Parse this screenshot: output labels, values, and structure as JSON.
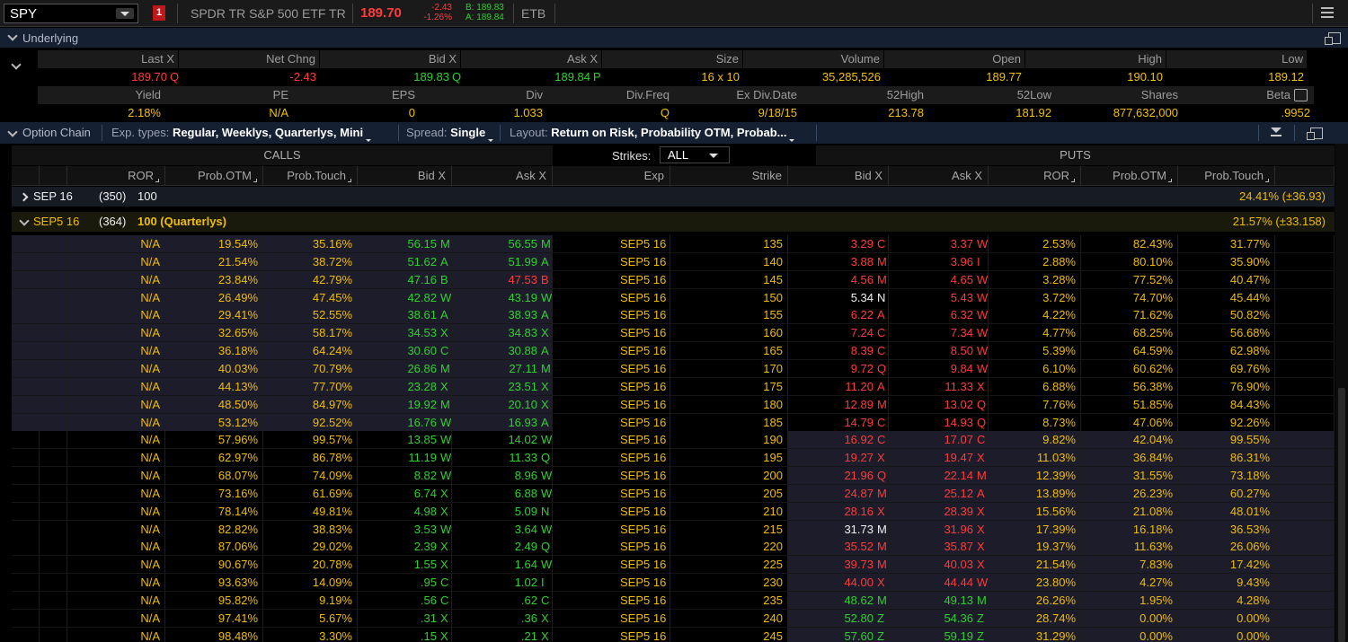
{
  "toolbar": {
    "symbol": "SPY",
    "alert_badge": "1",
    "description": "SPDR TR S&P 500 ETF TR",
    "last": "189.70",
    "net_change": "-2.43",
    "pct_change": "-1.26%",
    "bid_label": "B: 189.83",
    "ask_label": "A: 189.84",
    "etb": "ETB",
    "menu_icon": "hamburger-menu-icon"
  },
  "underlying": {
    "title": "Underlying",
    "row1_headers": [
      "Last X",
      "Net Chng",
      "Bid X",
      "Ask X",
      "Size",
      "Volume",
      "Open",
      "High",
      "Low"
    ],
    "row1_values": [
      {
        "v": "189.70",
        "x": "Q",
        "c": "red"
      },
      {
        "v": "-2.43",
        "x": "",
        "c": "red"
      },
      {
        "v": "189.83",
        "x": "Q",
        "c": "grn"
      },
      {
        "v": "189.84",
        "x": "P",
        "c": "grn"
      },
      {
        "v": "16 x 10",
        "x": "",
        "c": ""
      },
      {
        "v": "35,285,526",
        "x": "",
        "c": ""
      },
      {
        "v": "189.77",
        "x": "",
        "c": ""
      },
      {
        "v": "190.10",
        "x": "",
        "c": ""
      },
      {
        "v": "189.12",
        "x": "",
        "c": ""
      }
    ],
    "row2_headers": [
      "Yield",
      "PE",
      "EPS",
      "Div",
      "Div.Freq",
      "Ex Div.Date",
      "52High",
      "52Low",
      "Shares",
      "Beta"
    ],
    "row2_values": [
      "2.18%",
      "N/A",
      "0",
      "1.033",
      "Q",
      "9/18/15",
      "213.78",
      "181.92",
      "877,632,000",
      ".9952"
    ]
  },
  "option_chain": {
    "title": "Option Chain",
    "exp_types_label": "Exp. types:",
    "exp_types_value": "Regular, Weeklys, Quarterlys, Mini",
    "spread_label": "Spread:",
    "spread_value": "Single",
    "layout_label": "Layout:",
    "layout_value": "Return on Risk, Probability OTM, Probab...",
    "calls_label": "CALLS",
    "puts_label": "PUTS",
    "strikes_label": "Strikes:",
    "strikes_value": "ALL",
    "headers": [
      "ROR",
      "Prob.OTM",
      "Prob.Touch",
      "Bid X",
      "Ask X",
      "Exp",
      "Strike",
      "Bid X",
      "Ask X",
      "ROR",
      "Prob.OTM",
      "Prob.Touch"
    ],
    "expirations": [
      {
        "name": "SEP 16",
        "days": "(350)",
        "mult": "100",
        "iv": "24.41% (±36.93)",
        "expanded": false
      },
      {
        "name": "SEP5 16",
        "days": "(364)",
        "mult": "100 (Quarterlys)",
        "iv": "21.57% (±33.158)",
        "expanded": true
      }
    ],
    "rows": [
      [
        "N/A",
        "19.54%",
        "35.16%",
        "56.15",
        "M",
        "56.55",
        "M",
        "SEP5 16",
        "135",
        "3.29",
        "C",
        "3.37",
        "W",
        "2.53%",
        "82.43%",
        "31.77%"
      ],
      [
        "N/A",
        "21.54%",
        "38.72%",
        "51.62",
        "A",
        "51.99",
        "A",
        "SEP5 16",
        "140",
        "3.88",
        "M",
        "3.96",
        "I",
        "2.88%",
        "80.10%",
        "35.90%"
      ],
      [
        "N/A",
        "23.84%",
        "42.79%",
        "47.16",
        "B",
        "47.53",
        "B",
        "SEP5 16",
        "145",
        "4.56",
        "M",
        "4.65",
        "W",
        "3.28%",
        "77.52%",
        "40.47%"
      ],
      [
        "N/A",
        "26.49%",
        "47.45%",
        "42.82",
        "W",
        "43.19",
        "W",
        "SEP5 16",
        "150",
        "5.34",
        "N",
        "5.43",
        "W",
        "3.72%",
        "74.70%",
        "45.44%"
      ],
      [
        "N/A",
        "29.41%",
        "52.55%",
        "38.61",
        "A",
        "38.93",
        "A",
        "SEP5 16",
        "155",
        "6.22",
        "A",
        "6.32",
        "W",
        "4.22%",
        "71.62%",
        "50.82%"
      ],
      [
        "N/A",
        "32.65%",
        "58.17%",
        "34.53",
        "X",
        "34.83",
        "X",
        "SEP5 16",
        "160",
        "7.24",
        "C",
        "7.34",
        "W",
        "4.77%",
        "68.25%",
        "56.68%"
      ],
      [
        "N/A",
        "36.18%",
        "64.24%",
        "30.60",
        "C",
        "30.88",
        "A",
        "SEP5 16",
        "165",
        "8.39",
        "C",
        "8.50",
        "W",
        "5.39%",
        "64.59%",
        "62.98%"
      ],
      [
        "N/A",
        "40.03%",
        "70.79%",
        "26.86",
        "M",
        "27.11",
        "M",
        "SEP5 16",
        "170",
        "9.72",
        "Q",
        "9.84",
        "W",
        "6.10%",
        "60.62%",
        "69.76%"
      ],
      [
        "N/A",
        "44.13%",
        "77.70%",
        "23.28",
        "X",
        "23.51",
        "X",
        "SEP5 16",
        "175",
        "11.20",
        "A",
        "11.33",
        "X",
        "6.88%",
        "56.38%",
        "76.90%"
      ],
      [
        "N/A",
        "48.50%",
        "84.97%",
        "19.92",
        "M",
        "20.10",
        "X",
        "SEP5 16",
        "180",
        "12.89",
        "M",
        "13.02",
        "Q",
        "7.76%",
        "51.85%",
        "84.43%"
      ],
      [
        "N/A",
        "53.12%",
        "92.52%",
        "16.76",
        "W",
        "16.93",
        "A",
        "SEP5 16",
        "185",
        "14.79",
        "C",
        "14.93",
        "Q",
        "8.73%",
        "47.06%",
        "92.26%"
      ],
      [
        "N/A",
        "57.96%",
        "99.57%",
        "13.85",
        "W",
        "14.02",
        "W",
        "SEP5 16",
        "190",
        "16.92",
        "C",
        "17.07",
        "C",
        "9.82%",
        "42.04%",
        "99.55%"
      ],
      [
        "N/A",
        "62.97%",
        "86.78%",
        "11.19",
        "W",
        "11.33",
        "Q",
        "SEP5 16",
        "195",
        "19.27",
        "X",
        "19.47",
        "X",
        "11.03%",
        "36.84%",
        "86.31%"
      ],
      [
        "N/A",
        "68.07%",
        "74.09%",
        "8.82",
        "W",
        "8.96",
        "W",
        "SEP5 16",
        "200",
        "21.96",
        "Q",
        "22.14",
        "M",
        "12.39%",
        "31.55%",
        "73.18%"
      ],
      [
        "N/A",
        "73.16%",
        "61.69%",
        "6.74",
        "X",
        "6.88",
        "W",
        "SEP5 16",
        "205",
        "24.87",
        "M",
        "25.12",
        "A",
        "13.89%",
        "26.23%",
        "60.27%"
      ],
      [
        "N/A",
        "78.14%",
        "49.81%",
        "4.98",
        "X",
        "5.09",
        "N",
        "SEP5 16",
        "210",
        "28.16",
        "X",
        "28.39",
        "X",
        "15.56%",
        "21.08%",
        "48.01%"
      ],
      [
        "N/A",
        "82.82%",
        "38.83%",
        "3.53",
        "W",
        "3.64",
        "W",
        "SEP5 16",
        "215",
        "31.73",
        "M",
        "31.96",
        "X",
        "17.39%",
        "16.18%",
        "36.53%"
      ],
      [
        "N/A",
        "87.06%",
        "29.02%",
        "2.39",
        "X",
        "2.49",
        "Q",
        "SEP5 16",
        "220",
        "35.52",
        "M",
        "35.87",
        "X",
        "19.37%",
        "11.63%",
        "26.06%"
      ],
      [
        "N/A",
        "90.67%",
        "20.78%",
        "1.55",
        "X",
        "1.64",
        "W",
        "SEP5 16",
        "225",
        "39.73",
        "M",
        "40.03",
        "X",
        "21.54%",
        "7.83%",
        "17.42%"
      ],
      [
        "N/A",
        "93.63%",
        "14.09%",
        ".95",
        "C",
        "1.02",
        "I",
        "SEP5 16",
        "230",
        "44.00",
        "X",
        "44.44",
        "W",
        "23.80%",
        "4.27%",
        "9.43%"
      ],
      [
        "N/A",
        "95.82%",
        "9.19%",
        ".56",
        "C",
        ".62",
        "C",
        "SEP5 16",
        "235",
        "48.62",
        "M",
        "49.13",
        "M",
        "26.26%",
        "1.95%",
        "4.28%"
      ],
      [
        "N/A",
        "97.41%",
        "5.67%",
        ".31",
        "X",
        ".36",
        "X",
        "SEP5 16",
        "240",
        "52.80",
        "Z",
        "54.36",
        "Z",
        "28.74%",
        "0.00%",
        "0.00%"
      ],
      [
        "N/A",
        "98.48%",
        "3.30%",
        ".15",
        "X",
        ".21",
        "X",
        "SEP5 16",
        "245",
        "57.60",
        "Z",
        "59.19",
        "Z",
        "31.29%",
        "0.00%",
        "0.00%"
      ]
    ],
    "colors": {
      "yellow": "#f0be00",
      "green": "#2ed12e",
      "red": "#ff3b3b",
      "itm_bg": "#1c1c2a",
      "otm_bg": "#000000"
    }
  }
}
